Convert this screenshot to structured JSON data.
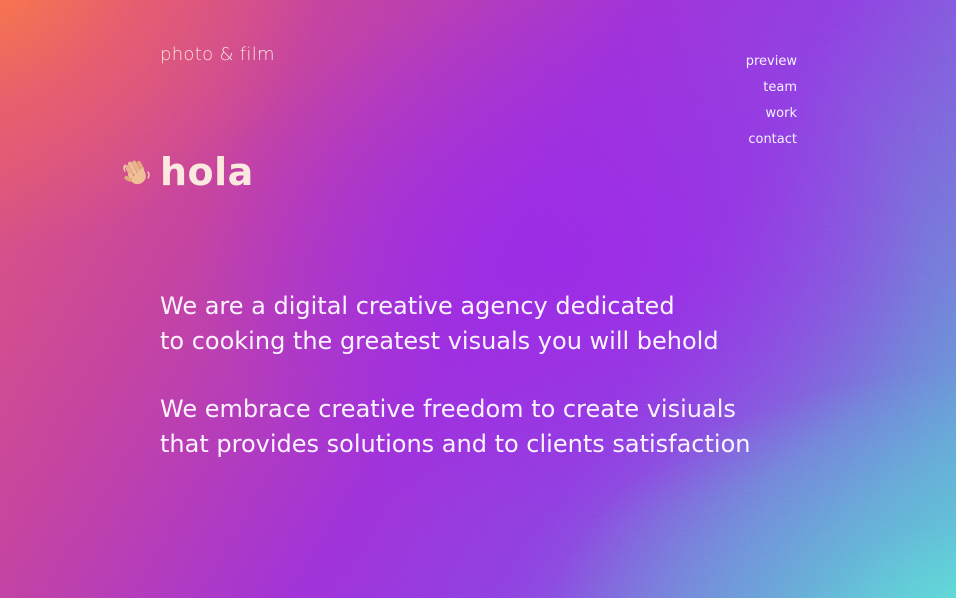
{
  "brand": {
    "logo": "photo & film"
  },
  "nav": {
    "items": [
      {
        "label": "preview"
      },
      {
        "label": "team"
      },
      {
        "label": "work"
      },
      {
        "label": "contact"
      }
    ]
  },
  "hero": {
    "icon": "waving-hand-icon",
    "greeting": "hola"
  },
  "intro": {
    "paragraphs": [
      {
        "lines": [
          "We are a digital creative agency dedicated",
          "to cooking the greatest visuals you will behold"
        ]
      },
      {
        "lines": [
          "We embrace creative freedom to create visiuals",
          "that provides solutions and to clients satisfaction"
        ]
      }
    ]
  },
  "colors": {
    "gradient_top_left": "#f07a48",
    "gradient_center": "#9030d8",
    "gradient_bottom_right": "#5ce2d4",
    "text": "#fbf3ff"
  }
}
